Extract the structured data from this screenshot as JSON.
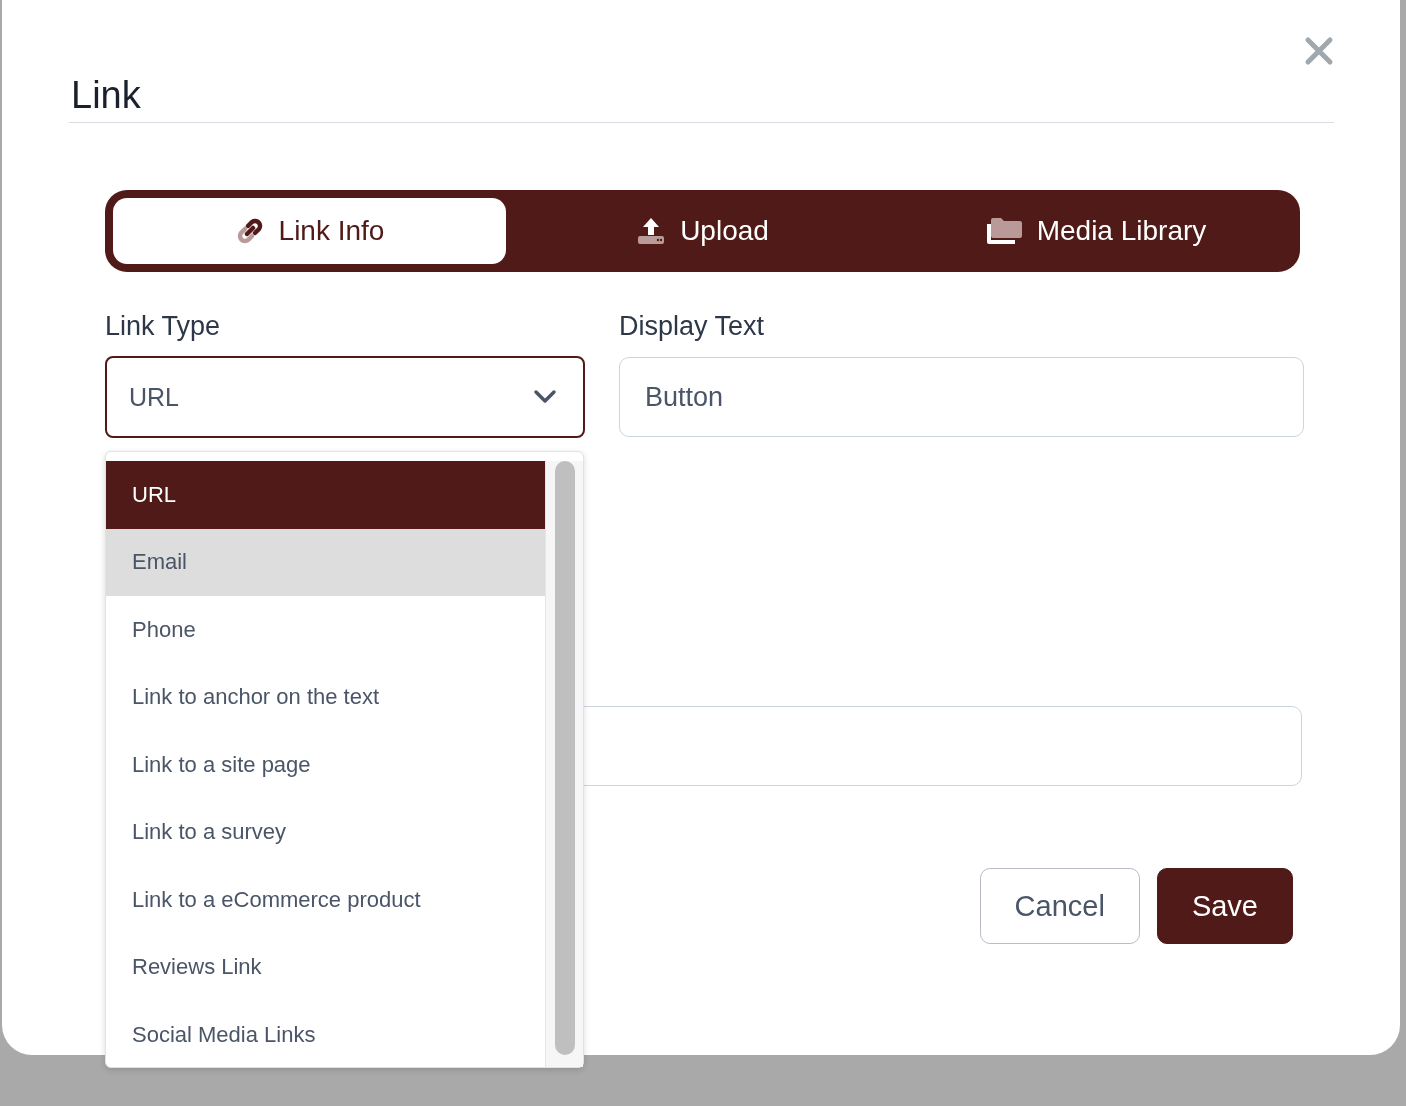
{
  "dialog": {
    "title": "Link"
  },
  "tabs": [
    {
      "label": "Link Info",
      "selected": true
    },
    {
      "label": "Upload",
      "selected": false
    },
    {
      "label": "Media Library",
      "selected": false
    }
  ],
  "link_type": {
    "label": "Link Type",
    "value": "URL",
    "expanded": true,
    "options": [
      {
        "label": "URL",
        "selected": true,
        "highlighted": false
      },
      {
        "label": "Email",
        "selected": false,
        "highlighted": true
      },
      {
        "label": "Phone",
        "selected": false,
        "highlighted": false
      },
      {
        "label": "Link to anchor on the text",
        "selected": false,
        "highlighted": false
      },
      {
        "label": "Link to a site page",
        "selected": false,
        "highlighted": false
      },
      {
        "label": "Link to a survey",
        "selected": false,
        "highlighted": false
      },
      {
        "label": "Link to a eCommerce product",
        "selected": false,
        "highlighted": false
      },
      {
        "label": "Reviews Link",
        "selected": false,
        "highlighted": false
      },
      {
        "label": "Social Media Links",
        "selected": false,
        "highlighted": false
      }
    ]
  },
  "display_text": {
    "label": "Display Text",
    "value": "Button"
  },
  "buttons": [
    {
      "label": "Cancel",
      "kind": "secondary"
    },
    {
      "label": "Save",
      "kind": "primary"
    }
  ]
}
